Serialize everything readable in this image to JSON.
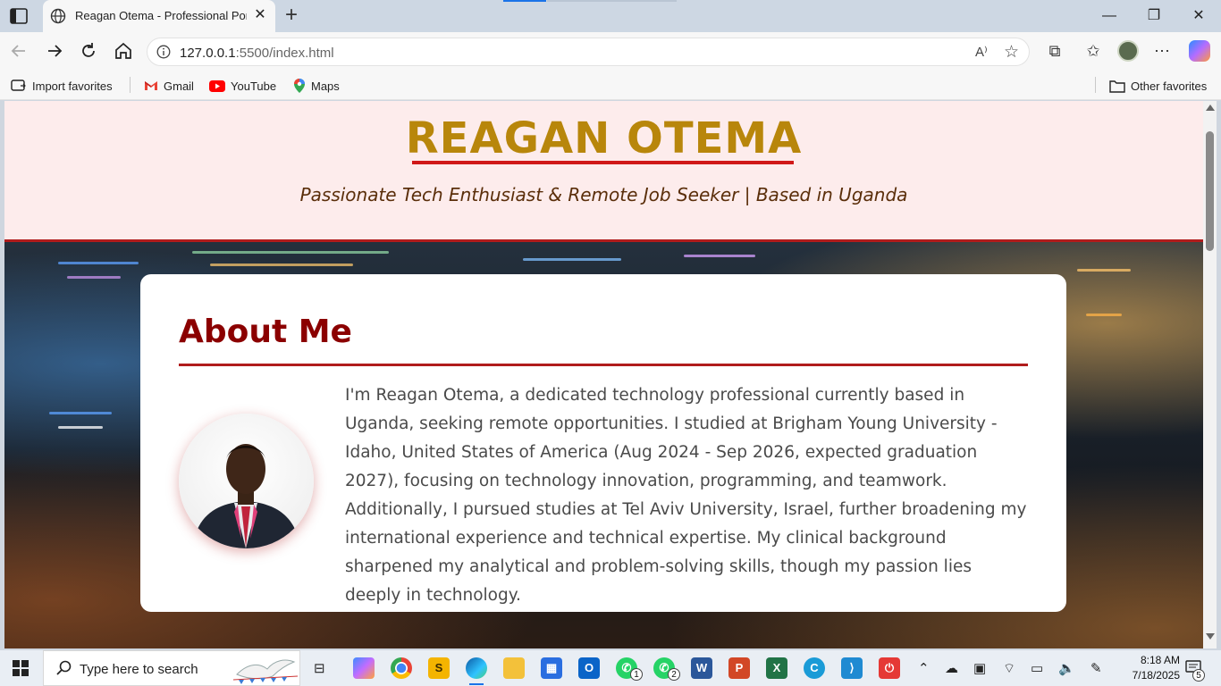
{
  "browser": {
    "tab_title": "Reagan Otema - Professional Port",
    "url_host": "127.0.0.1",
    "url_path": ":5500/index.html",
    "favorites": {
      "import": "Import favorites",
      "gmail": "Gmail",
      "youtube": "YouTube",
      "maps": "Maps",
      "other": "Other favorites"
    }
  },
  "page": {
    "header": {
      "name": "REAGAN OTEMA",
      "tagline": "Passionate Tech Enthusiast & Remote Job Seeker | Based in Uganda"
    },
    "about": {
      "title": "About Me",
      "text": "I'm Reagan Otema, a dedicated technology professional currently based in Uganda, seeking remote opportunities. I studied at Brigham Young University - Idaho, United States of America (Aug 2024 - Sep 2026, expected graduation 2027), focusing on technology innovation, programming, and teamwork. Additionally, I pursued studies at Tel Aviv University, Israel, further broadening my international experience and technical expertise. My clinical background sharpened my analytical and problem-solving skills, though my passion lies deeply in technology."
    }
  },
  "taskbar": {
    "search_placeholder": "Type here to search",
    "whatsapp_badge_1": "1",
    "whatsapp_badge_2": "2",
    "time": "8:18 AM",
    "date": "7/18/2025",
    "notification_count": "5"
  },
  "colors": {
    "name_gold": "#b8860b",
    "accent_red": "#b01c1c",
    "about_title": "#8b0000",
    "header_bg": "#fdecec"
  }
}
